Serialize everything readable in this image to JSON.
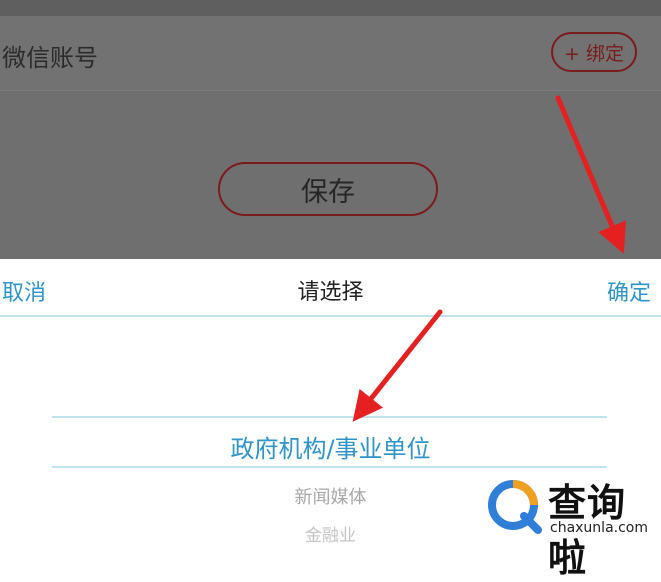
{
  "background_form": {
    "wechat_label": "微信账号",
    "bind_label": "+ 绑定",
    "save_label": "保存"
  },
  "picker": {
    "cancel_label": "取消",
    "title": "请选择",
    "confirm_label": "确定",
    "options": [
      "政府机构/事业单位",
      "新闻媒体",
      "金融业"
    ],
    "selected_index": 0
  },
  "watermark": {
    "title": "查询啦",
    "url": "chaxunla.com"
  },
  "colors": {
    "accent_blue": "#2f94c8",
    "arrow_red": "#e52020",
    "button_border": "#7a1c1c",
    "divider": "#bfe3ef"
  }
}
